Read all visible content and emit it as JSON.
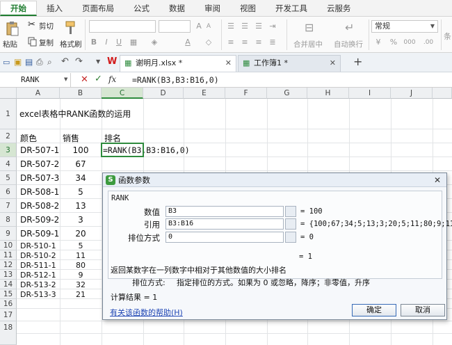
{
  "menu": {
    "tabs": [
      "开始",
      "插入",
      "页面布局",
      "公式",
      "数据",
      "审阅",
      "视图",
      "开发工具",
      "云服务"
    ],
    "active_tab": "开始"
  },
  "ribbon": {
    "paste_label": "粘贴",
    "cut_label": "剪切",
    "copy_label": "复制",
    "format_painter_label": "格式刷",
    "merge_center_label": "合并居中",
    "wrap_label": "自动换行",
    "number_format": "常规",
    "percent_symbol": "%",
    "thousands_symbol": "000"
  },
  "documents": {
    "tabs": [
      {
        "label": "谢明月.xlsx *",
        "active": true
      },
      {
        "label": "工作簿1 *",
        "active": false
      }
    ],
    "add_tab": "+"
  },
  "formula_bar": {
    "name_box": "RANK",
    "fx_label": "fx",
    "formula": "=RANK(B3,B3:B16,0)"
  },
  "sheet": {
    "columns": [
      "A",
      "B",
      "C",
      "D",
      "E",
      "F",
      "G",
      "H",
      "I",
      "J"
    ],
    "rows": [
      "1",
      "2",
      "3",
      "4",
      "5",
      "6",
      "7",
      "8",
      "9",
      "10",
      "11",
      "12",
      "13",
      "14",
      "15",
      "16",
      "17",
      "18"
    ],
    "title": "excel表格中RANK函数的运用",
    "header_color": "颜色",
    "header_sales": "销售",
    "header_rank": "排名",
    "data": [
      {
        "color": "DR-507-1",
        "sales": "100"
      },
      {
        "color": "DR-507-2",
        "sales": "67"
      },
      {
        "color": "DR-507-3",
        "sales": "34"
      },
      {
        "color": "DR-508-1",
        "sales": "5"
      },
      {
        "color": "DR-508-2",
        "sales": "13"
      },
      {
        "color": "DR-509-2",
        "sales": "3"
      },
      {
        "color": "DR-509-1",
        "sales": "20"
      },
      {
        "color": "DR-510-1",
        "sales": "5"
      },
      {
        "color": "DR-510-2",
        "sales": "11"
      },
      {
        "color": "DR-511-1",
        "sales": "80"
      },
      {
        "color": "DR-512-1",
        "sales": "9"
      },
      {
        "color": "DR-513-2",
        "sales": "32"
      },
      {
        "color": "DR-513-3",
        "sales": "21"
      }
    ],
    "c3_formula": "=RANK(B3,B3:B16,0)"
  },
  "dialog": {
    "title": "函数参数",
    "function_name": "RANK",
    "args": [
      {
        "label": "数值",
        "input": "B3",
        "result": "= 100"
      },
      {
        "label": "引用",
        "input": "B3:B16",
        "result": "= {100;67;34;5;13;3;20;5;11;80;9;11;32…"
      },
      {
        "label": "排位方式",
        "input": "0",
        "result": "= 0"
      }
    ],
    "result_preview": "= 1",
    "description": "返回某数字在一列数字中相对于其他数值的大小排名",
    "param_help_label": "排位方式:",
    "param_help_text": "指定排位的方式。如果为 0 或忽略，降序；非零值，升序",
    "calc_result": "计算结果  =  1",
    "help_link": "有关该函数的帮助(H)",
    "ok_label": "确定",
    "cancel_label": "取消",
    "close_glyph": "✕"
  },
  "colors": {
    "accent": "#1e7c2f",
    "selection": "#2e8b3d"
  }
}
